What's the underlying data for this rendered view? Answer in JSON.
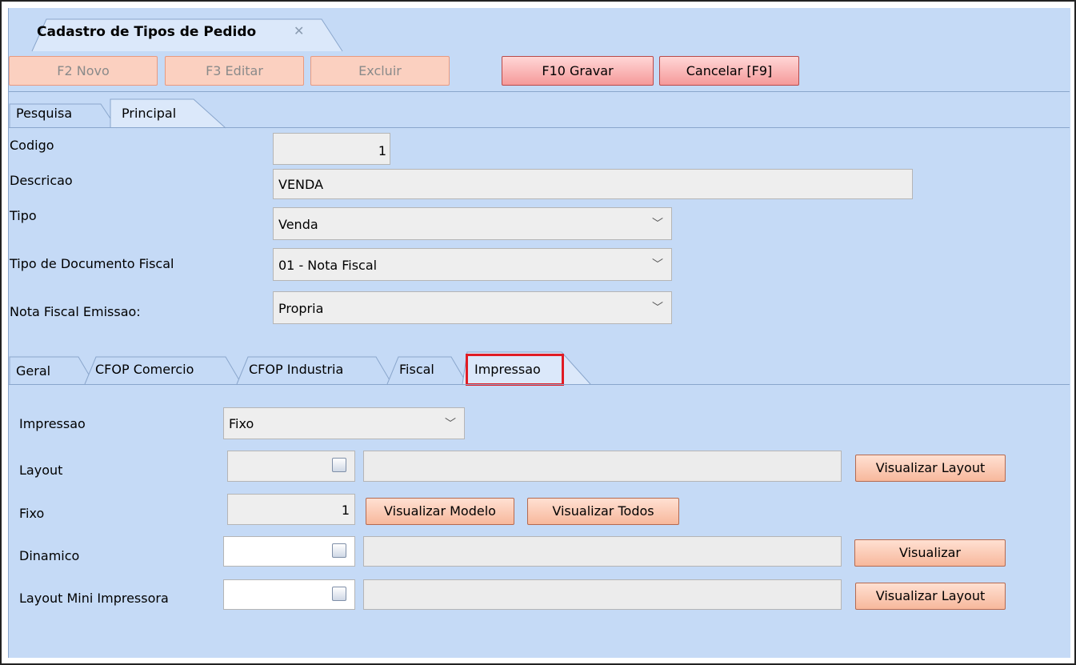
{
  "window": {
    "tab_title": "Cadastro de Tipos de Pedido",
    "tab_close": "✕"
  },
  "toolbar": {
    "new_label": "F2 Novo",
    "edit_label": "F3 Editar",
    "delete_label": "Excluir",
    "save_label": "F10 Gravar",
    "cancel_label": "Cancelar [F9]"
  },
  "main_tabs": [
    "Pesquisa",
    "Principal"
  ],
  "form": {
    "codigo_label": "Codigo",
    "codigo_value": "1",
    "descricao_label": "Descricao",
    "descricao_value": "VENDA",
    "tipo_label": "Tipo",
    "tipo_value": "Venda",
    "tipo_doc_label": "Tipo de Documento Fiscal",
    "tipo_doc_value": "01 - Nota Fiscal",
    "nf_emissao_label": "Nota Fiscal Emissao:",
    "nf_emissao_value": "Propria"
  },
  "sub_tabs": [
    "Geral",
    "CFOP Comercio",
    "CFOP Industria",
    "Fiscal",
    "Impressao"
  ],
  "active_sub_tab": "Impressao",
  "impressao": {
    "impressao_label": "Impressao",
    "impressao_value": "Fixo",
    "layout_label": "Layout",
    "layout_button": "Visualizar Layout",
    "fixo_label": "Fixo",
    "fixo_value": "1",
    "fixo_btn_modelo": "Visualizar Modelo",
    "fixo_btn_todos": "Visualizar Todos",
    "dinamico_label": "Dinamico",
    "dinamico_button": "Visualizar",
    "mini_label": "Layout Mini Impressora",
    "mini_button": "Visualizar Layout"
  },
  "colors": {
    "panel": "#c5daf6",
    "highlight": "#e01c24"
  },
  "icons": {
    "dropdown": "chevron-down-icon",
    "search": "search-icon",
    "close": "close-icon"
  }
}
